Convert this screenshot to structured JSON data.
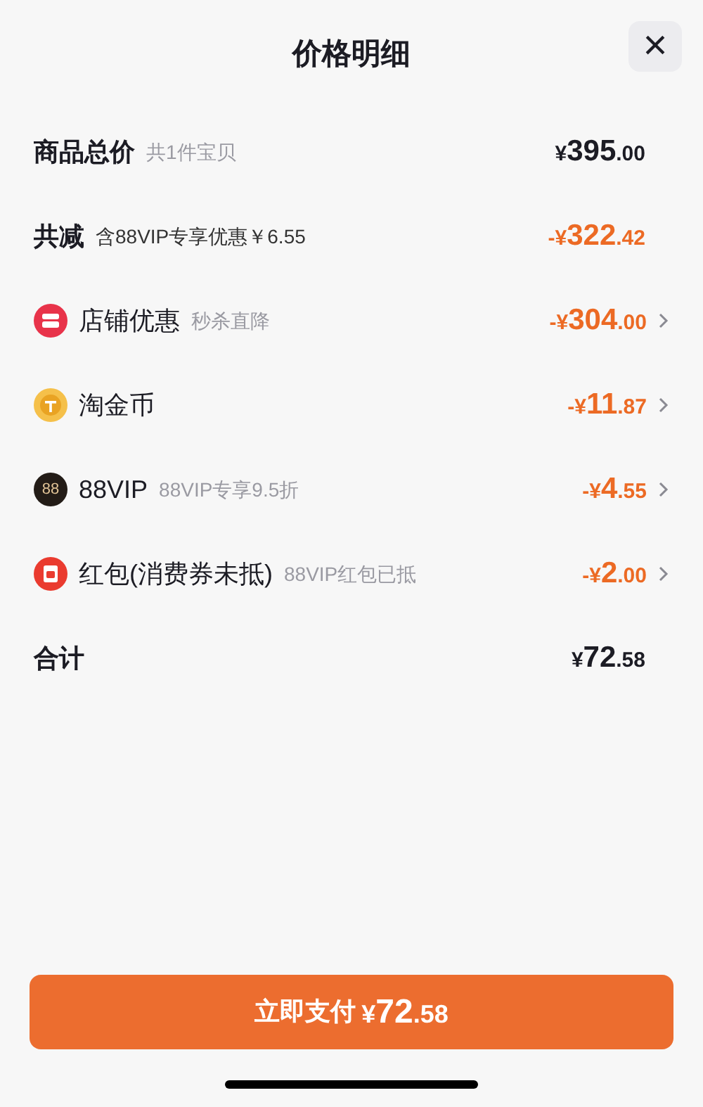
{
  "title": "价格明细",
  "close": "×",
  "rows": [
    {
      "kind": "subtotal",
      "label": "商品总价",
      "note": "共1件宝贝",
      "amount": {
        "prefix": "¥",
        "whole": "395",
        "fraction": ".00"
      }
    },
    {
      "kind": "savings",
      "label": "共减",
      "note": "含88VIP专享优惠￥6.55",
      "amount": {
        "prefix": "-¥",
        "whole": "322",
        "fraction": ".42"
      }
    },
    {
      "kind": "shop",
      "label": "店铺优惠",
      "note": "秒杀直降",
      "amount": {
        "prefix": "-¥",
        "whole": "304",
        "fraction": ".00"
      }
    },
    {
      "kind": "coin",
      "label": "淘金币",
      "amount": {
        "prefix": "-¥",
        "whole": "11",
        "fraction": ".87"
      }
    },
    {
      "kind": "vip",
      "icon_text": "88",
      "label": "88VIP",
      "note": "88VIP专享9.5折",
      "amount": {
        "prefix": "-¥",
        "whole": "4",
        "fraction": ".55"
      }
    },
    {
      "kind": "packet",
      "label": "红包(消费券未抵)",
      "note": "88VIP红包已抵",
      "amount": {
        "prefix": "-¥",
        "whole": "2",
        "fraction": ".00"
      }
    },
    {
      "kind": "total",
      "label": "合计",
      "amount": {
        "prefix": "¥",
        "whole": "72",
        "fraction": ".58"
      }
    }
  ],
  "pay_button": {
    "label": "立即支付",
    "amount": {
      "prefix": "¥",
      "whole": "72",
      "fraction": ".58"
    }
  }
}
